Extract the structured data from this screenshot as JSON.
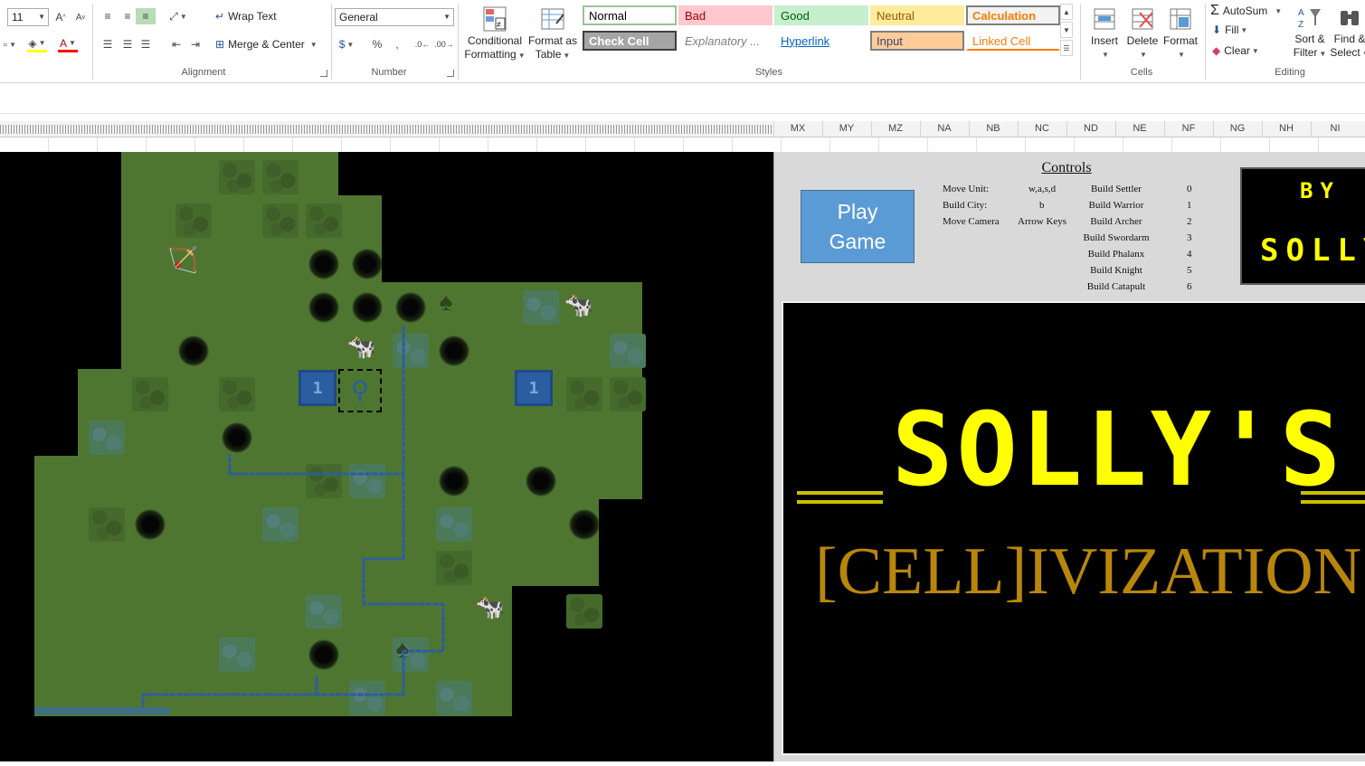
{
  "ribbon": {
    "font_size": "11",
    "wrap_text": "Wrap Text",
    "merge_center": "Merge & Center",
    "number_format": "General",
    "conditional_formatting": "Conditional Formatting",
    "format_as_table": "Format as Table",
    "format_as_table_line1": "Format as",
    "format_as_table_line2": "Table",
    "cond_line1": "Conditional",
    "cond_line2": "Formatting",
    "groups": {
      "alignment": "Alignment",
      "number": "Number",
      "styles": "Styles",
      "cells": "Cells",
      "editing": "Editing"
    },
    "styles": [
      {
        "label": "Normal",
        "color": "#000000",
        "bg": "#ffffff",
        "border": "#9ac29a"
      },
      {
        "label": "Bad",
        "color": "#9c0006",
        "bg": "#ffc7ce",
        "border": "#ffc7ce"
      },
      {
        "label": "Good",
        "color": "#006100",
        "bg": "#c6efce",
        "border": "#c6efce"
      },
      {
        "label": "Neutral",
        "color": "#9c5700",
        "bg": "#ffeb9c",
        "border": "#ffeb9c"
      },
      {
        "label": "Calculation",
        "color": "#fa7d00",
        "bg": "#f2f2f2",
        "border": "#7f7f7f"
      },
      {
        "label": "Check Cell",
        "color": "#ffffff",
        "bg": "#a5a5a5",
        "border": "#3f3f3f"
      },
      {
        "label": "Explanatory ...",
        "color": "#7f7f7f",
        "bg": "#ffffff",
        "border": "#ffffff"
      },
      {
        "label": "Hyperlink",
        "color": "#0563c1",
        "bg": "#ffffff",
        "border": "#ffffff"
      },
      {
        "label": "Input",
        "color": "#3f3f76",
        "bg": "#ffcc99",
        "border": "#7f7f7f"
      },
      {
        "label": "Linked Cell",
        "color": "#fa7d00",
        "bg": "#ffffff",
        "border": "#ffffff"
      }
    ],
    "cells": {
      "insert": "Insert",
      "delete": "Delete",
      "format": "Format"
    },
    "editing": {
      "autosum": "AutoSum",
      "fill": "Fill",
      "clear": "Clear",
      "sort_line1": "Sort &",
      "sort_line2": "Filter",
      "find_line1": "Find &",
      "find_line2": "Select"
    }
  },
  "columns": [
    "MX",
    "MY",
    "MZ",
    "NA",
    "NB",
    "NC",
    "ND",
    "NE",
    "NF",
    "NG",
    "NH",
    "NI"
  ],
  "panel": {
    "play_button": "Play\nGame",
    "controls_title": "Controls",
    "controls_left": [
      {
        "action": "Move Unit:",
        "key": "w,a,s,d"
      },
      {
        "action": "Build City:",
        "key": "b"
      },
      {
        "action": "Move Camera",
        "key": "Arrow Keys"
      }
    ],
    "controls_right": [
      {
        "action": "Build Settler",
        "key": "0"
      },
      {
        "action": "Build Warrior",
        "key": "1"
      },
      {
        "action": "Build Archer",
        "key": "2"
      },
      {
        "action": "Build Swordarm",
        "key": "3"
      },
      {
        "action": "Build Phalanx",
        "key": "4"
      },
      {
        "action": "Build Knight",
        "key": "5"
      },
      {
        "action": "Build Catapult",
        "key": "6"
      }
    ],
    "by_label": "BY",
    "author_label": "SOLLY",
    "game_title": "SOLLY'S",
    "game_subtitle": "[CELL]IVIZATION"
  },
  "map": {
    "city_label": "1",
    "colors": {
      "grass": "#527a33",
      "city": "#2b5da1",
      "river": "#2b5da1"
    }
  }
}
